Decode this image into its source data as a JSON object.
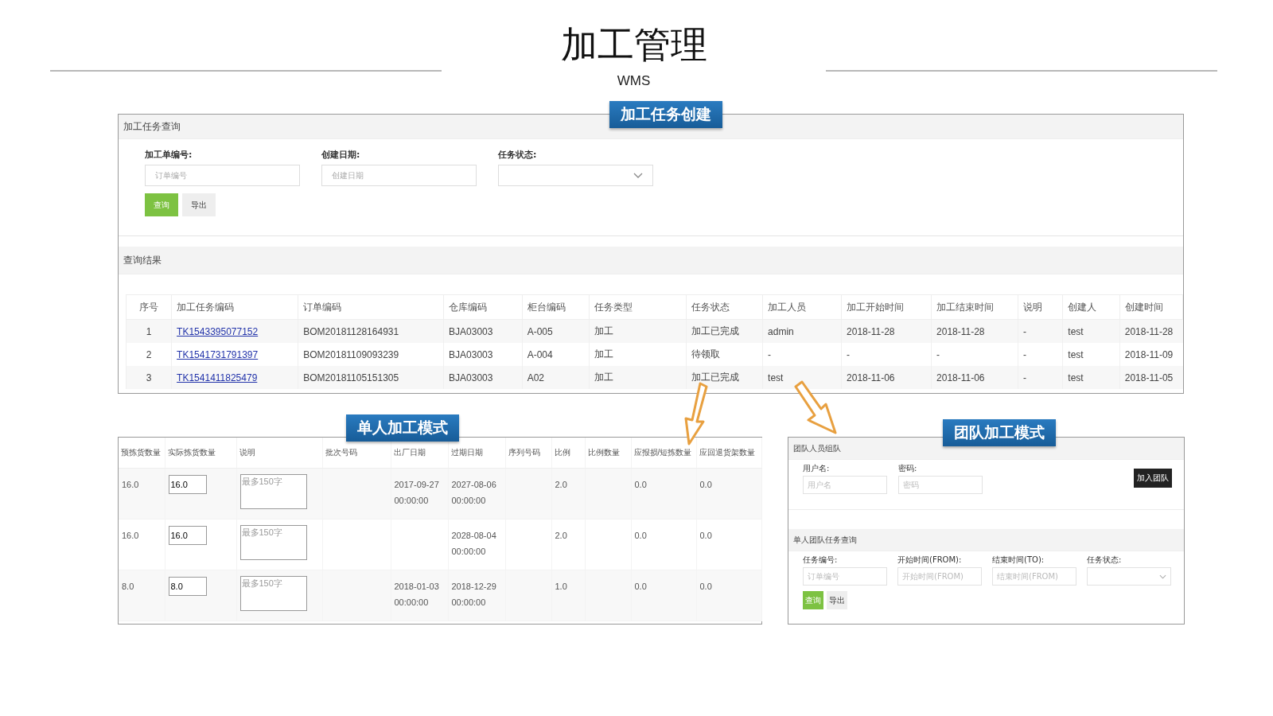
{
  "title": "加工管理",
  "subtitle": "WMS",
  "task_panel": {
    "badge": "加工任务创建",
    "header": "加工任务查询",
    "fields": [
      {
        "label": "加工单编号:",
        "placeholder": "订单编号",
        "kind": "text"
      },
      {
        "label": "创建日期:",
        "placeholder": "创建日期",
        "kind": "text"
      },
      {
        "label": "任务状态:",
        "kind": "select"
      }
    ],
    "buttons": [
      {
        "label": "查询",
        "kind": "primary"
      },
      {
        "label": "导出",
        "kind": "default"
      }
    ],
    "results_header": "查询结果",
    "table": {
      "columns": [
        {
          "label": "序号",
          "kind": "center"
        },
        {
          "label": "加工任务编码",
          "kind": "link"
        },
        {
          "label": "订单编码",
          "kind": "text"
        },
        {
          "label": "仓库编码",
          "kind": "text"
        },
        {
          "label": "柜台编码",
          "kind": "text"
        },
        {
          "label": "任务类型",
          "kind": "text"
        },
        {
          "label": "任务状态",
          "kind": "text"
        },
        {
          "label": "加工人员",
          "kind": "text"
        },
        {
          "label": "加工开始时间",
          "kind": "text"
        },
        {
          "label": "加工结束时间",
          "kind": "text"
        },
        {
          "label": "说明",
          "kind": "text"
        },
        {
          "label": "创建人",
          "kind": "text"
        },
        {
          "label": "创建时间",
          "kind": "text"
        }
      ],
      "rows": [
        [
          "1",
          "TK1543395077152",
          "BOM20181128164931",
          "BJA03003",
          "A-005",
          "加工",
          "加工已完成",
          "admin",
          "2018-11-28",
          "2018-11-28",
          "-",
          "test",
          "2018-11-28"
        ],
        [
          "2",
          "TK1541731791397",
          "BOM20181109093239",
          "BJA03003",
          "A-004",
          "加工",
          "待领取",
          "-",
          "-",
          "-",
          "-",
          "test",
          "2018-11-09"
        ],
        [
          "3",
          "TK1541411825479",
          "BOM20181105151305",
          "BJA03003",
          "A02",
          "加工",
          "加工已完成",
          "test",
          "2018-11-06",
          "2018-11-06",
          "-",
          "test",
          "2018-11-05"
        ]
      ]
    }
  },
  "single_panel": {
    "badge": "单人加工模式",
    "table": {
      "columns": [
        {
          "label": "预拣货数量",
          "kind": "text"
        },
        {
          "label": "实际拣货数量",
          "kind": "input"
        },
        {
          "label": "说明",
          "kind": "textarea"
        },
        {
          "label": "批次号码",
          "kind": "text"
        },
        {
          "label": "出厂日期",
          "kind": "text"
        },
        {
          "label": "过期日期",
          "kind": "text"
        },
        {
          "label": "序列号码",
          "kind": "text"
        },
        {
          "label": "比例",
          "kind": "text"
        },
        {
          "label": "比例数量",
          "kind": "text"
        },
        {
          "label": "应报损/短拣数量",
          "kind": "text"
        },
        {
          "label": "应回退货架数量",
          "kind": "text"
        }
      ],
      "rows": [
        [
          "16.0",
          "16.0",
          {
            "placeholder": "最多150字"
          },
          null,
          "2017-09-27 00:00:00",
          "2027-08-06 00:00:00",
          null,
          "2.0",
          null,
          "0.0",
          "0.0"
        ],
        [
          "16.0",
          "16.0",
          {
            "placeholder": "最多150字"
          },
          null,
          null,
          "2028-08-04 00:00:00",
          null,
          "2.0",
          null,
          "0.0",
          "0.0"
        ],
        [
          "8.0",
          "8.0",
          {
            "placeholder": "最多150字"
          },
          null,
          "2018-01-03 00:00:00",
          "2018-12-29 00:00:00",
          null,
          "1.0",
          null,
          "0.0",
          "0.0"
        ]
      ]
    }
  },
  "team_panel": {
    "badge": "团队加工模式",
    "join_header": "团队人员组队",
    "join_fields": [
      {
        "label": "用户名:",
        "placeholder": "用户名",
        "kind": "text"
      },
      {
        "label": "密码:",
        "placeholder": "密码",
        "kind": "text"
      }
    ],
    "join_button": "加入团队",
    "query_header": "单人团队任务查询",
    "query_fields": [
      {
        "label": "任务编号:",
        "placeholder": "订单编号",
        "kind": "text"
      },
      {
        "label": "开始时间(FROM):",
        "placeholder": "开始时间(FROM)",
        "kind": "text"
      },
      {
        "label": "结束时间(TO):",
        "placeholder": "结束时间(FROM)",
        "kind": "text"
      },
      {
        "label": "任务状态:",
        "kind": "select"
      }
    ],
    "buttons": [
      {
        "label": "查询",
        "kind": "primary"
      },
      {
        "label": "导出",
        "kind": "default"
      }
    ]
  }
}
